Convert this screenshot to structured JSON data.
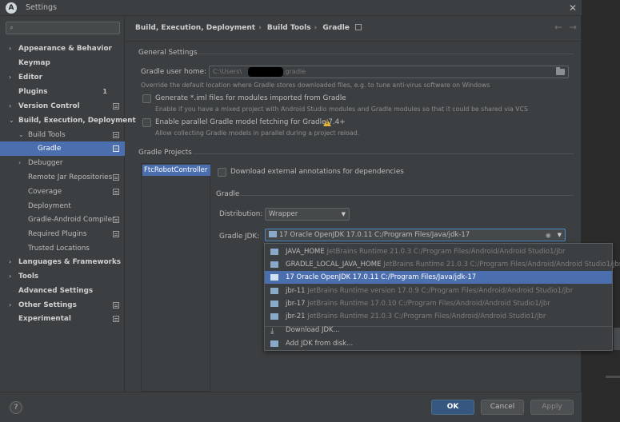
{
  "window": {
    "title": "Settings",
    "app_icon_letter": "A",
    "close_glyph": "✕"
  },
  "sidebar": {
    "search_placeholder": "",
    "items": [
      {
        "label": "Appearance & Behavior",
        "arrow": "›",
        "bold": true
      },
      {
        "label": "Keymap",
        "bold": true
      },
      {
        "label": "Editor",
        "arrow": "›",
        "bold": true
      },
      {
        "label": "Plugins",
        "bold": true,
        "badge": "1"
      },
      {
        "label": "Version Control",
        "arrow": "›",
        "bold": true
      },
      {
        "label": "Build, Execution, Deployment",
        "arrow": "⌄",
        "bold": true
      },
      {
        "label": "Build Tools",
        "arrow": "⌄"
      },
      {
        "label": "Gradle"
      },
      {
        "label": "Debugger",
        "arrow": "›"
      },
      {
        "label": "Remote Jar Repositories"
      },
      {
        "label": "Coverage"
      },
      {
        "label": "Deployment"
      },
      {
        "label": "Gradle-Android Compiler"
      },
      {
        "label": "Required Plugins"
      },
      {
        "label": "Trusted Locations"
      },
      {
        "label": "Languages & Frameworks",
        "arrow": "›",
        "bold": true
      },
      {
        "label": "Tools",
        "arrow": "›",
        "bold": true
      },
      {
        "label": "Advanced Settings",
        "bold": true
      },
      {
        "label": "Other Settings",
        "arrow": "›",
        "bold": true
      },
      {
        "label": "Experimental",
        "bold": true
      }
    ]
  },
  "breadcrumb": {
    "part1": "Build, Execution, Deployment",
    "part2": "Build Tools",
    "part3": "Gradle",
    "sep": "›",
    "back": "←",
    "forward": "→"
  },
  "general": {
    "section_title": "General Settings",
    "home_label": "Gradle user home:",
    "home_value_prefix": "C:\\Users\\",
    "home_value_suffix": ".gradle",
    "home_hint": "Override the default location where Gradle stores downloaded files, e.g. to tune anti-virus software on Windows",
    "iml_label": "Generate *.iml files for modules imported from Gradle",
    "iml_hint": "Enable if you have a mixed project with Android Studio modules and Gradle modules so that it could be shared via VCS",
    "parallel_label": "Enable parallel Gradle model fetching for Gradle 7.4+",
    "parallel_hint": "Allow collecting Gradle models in parallel during a project reload."
  },
  "projects": {
    "section_title": "Gradle Projects",
    "items": [
      "FtcRobotController"
    ],
    "download_annotations_label": "Download external annotations for dependencies",
    "gradle_section": "Gradle",
    "distribution_label": "Distribution:",
    "distribution_value": "Wrapper",
    "jdk_label": "Gradle JDK:",
    "jdk_value": "17 Oracle OpenJDK 17.0.11 C:/Program Files/Java/jdk-17"
  },
  "jdk_popup": {
    "items": [
      {
        "name": "JAVA_HOME",
        "desc": "JetBrains Runtime 21.0.3 C:/Program Files/Android/Android Studio1/jbr"
      },
      {
        "name": "GRADLE_LOCAL_JAVA_HOME",
        "desc": "JetBrains Runtime 21.0.3 C:/Program Files/Android/Android Studio1/jbr"
      },
      {
        "name": "17 Oracle OpenJDK 17.0.11 C:/Program Files/Java/jdk-17",
        "desc": ""
      },
      {
        "name": "jbr-11",
        "desc": "JetBrains Runtime version 17.0.9 C:/Program Files/Android/Android Studio1/jbr"
      },
      {
        "name": "jbr-17",
        "desc": "JetBrains Runtime 17.0.10 C:/Program Files/Android/Android Studio1/jbr"
      },
      {
        "name": "jbr-21",
        "desc": "JetBrains Runtime 21.0.3 C:/Program Files/Android/Android Studio1/jbr"
      }
    ],
    "download_jdk": "Download JDK...",
    "add_jdk": "Add JDK from disk..."
  },
  "footer": {
    "help": "?",
    "ok": "OK",
    "cancel": "Cancel",
    "apply": "Apply"
  },
  "colors": {
    "accent": "#4b6eaf",
    "panel": "#3c3f41",
    "warning": "#e2b33a"
  }
}
